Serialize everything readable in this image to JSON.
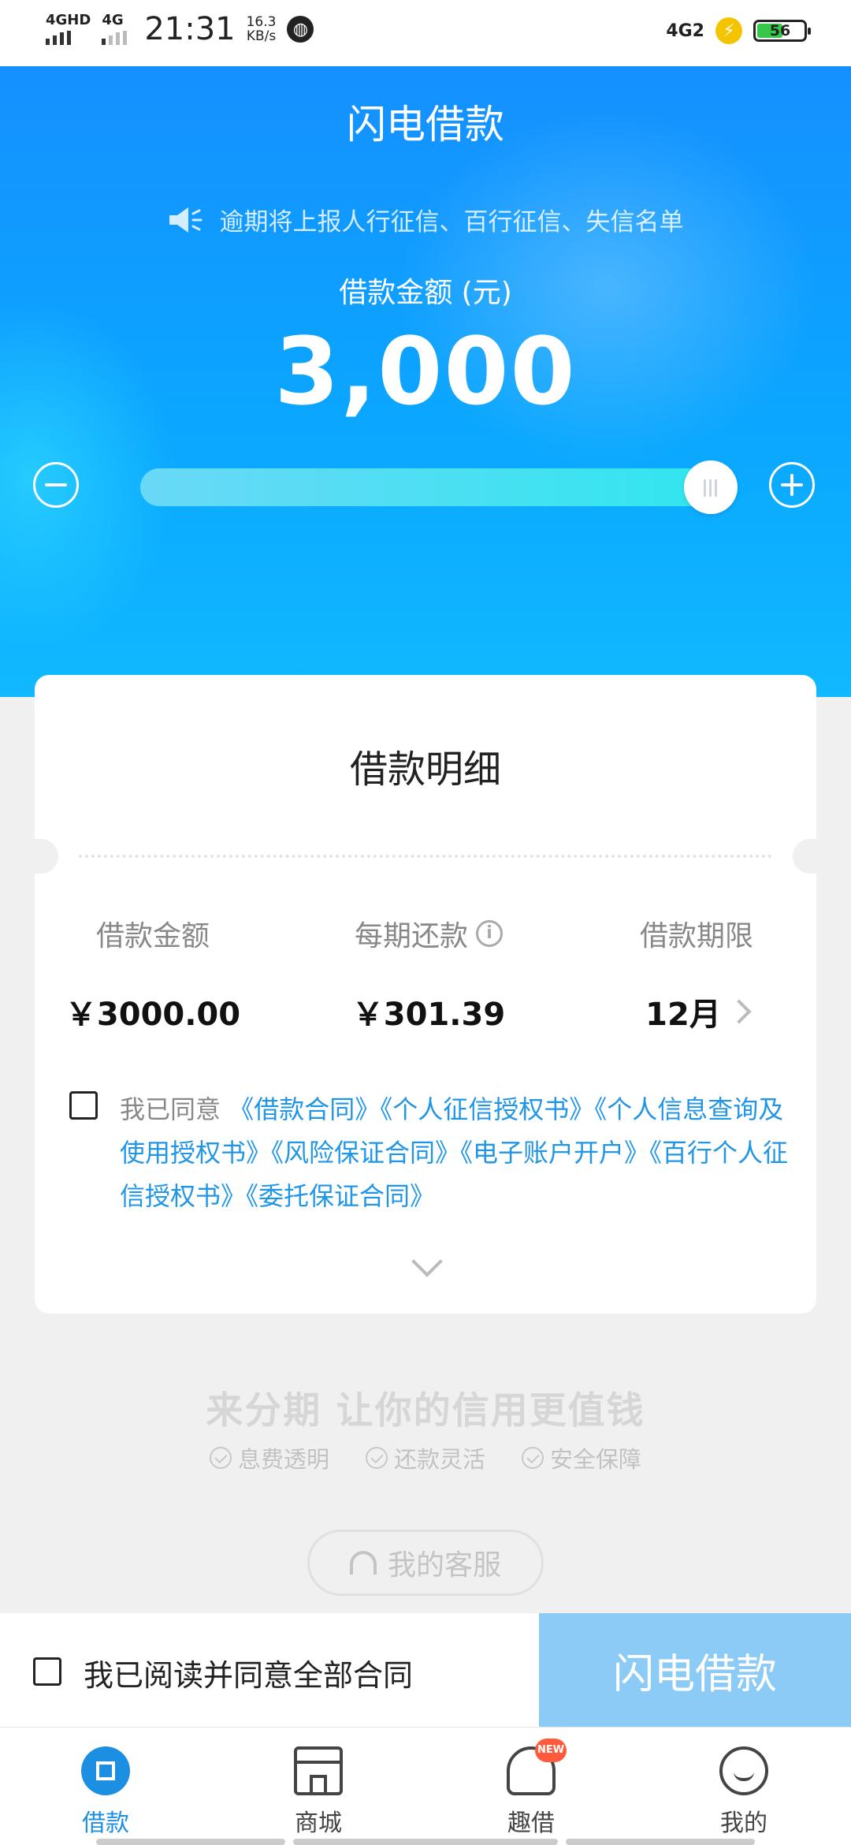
{
  "status_bar": {
    "network_left": "4GHD",
    "network_left2": "4G",
    "time": "21:31",
    "speed_value": "16.3",
    "speed_unit": "KB/s",
    "network_right": "4G2",
    "battery": "56",
    "battery_level": 0.56,
    "battery_color": "#35c849"
  },
  "hero": {
    "title": "闪电借款",
    "notice": "逾期将上报人行征信、百行征信、失信名单",
    "amount_label": "借款金额 (元)",
    "amount": "3,000",
    "slider_level": 1.0,
    "accent_color": "#1590ff"
  },
  "card": {
    "title": "借款明细",
    "columns": [
      {
        "label": "借款金额",
        "value": "￥3000.00"
      },
      {
        "label": "每期还款",
        "value": "￥301.39"
      },
      {
        "label": "借款期限",
        "value": "12月"
      }
    ],
    "agreement_prefix": "我已同意",
    "agreement_links": "《借款合同》《个人征信授权书》《个人信息查询及使用授权书》《风险保证合同》《电子账户开户》《百行个人征信授权书》《委托保证合同》",
    "link_color": "#2196e6"
  },
  "promo": {
    "slogan": "来分期 让你的信用更值钱",
    "features": [
      "息费透明",
      "还款灵活",
      "安全保障"
    ],
    "service_button": "我的客服"
  },
  "action_bar": {
    "agree_all": "我已阅读并同意全部合同",
    "borrow_button": "闪电借款",
    "button_color": "#8ccbf6"
  },
  "tabs": [
    {
      "label": "借款",
      "icon": "loan-icon",
      "active": true
    },
    {
      "label": "商城",
      "icon": "shop-icon",
      "active": false
    },
    {
      "label": "趣借",
      "icon": "fun-icon",
      "badge": "NEW",
      "active": false
    },
    {
      "label": "我的",
      "icon": "profile-icon",
      "active": false
    }
  ]
}
